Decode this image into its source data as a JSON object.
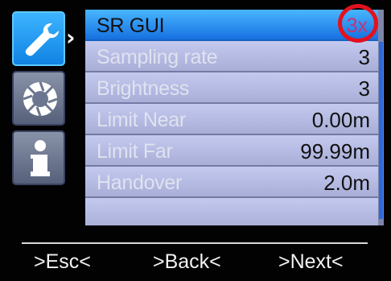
{
  "sidebar": {
    "tabs": [
      {
        "icon": "wrench-icon",
        "selected": true
      },
      {
        "icon": "camera-aperture-icon",
        "selected": false
      },
      {
        "icon": "info-icon",
        "selected": false
      }
    ],
    "indicator": "›"
  },
  "menu": {
    "title": "SR GUI",
    "title_value": "3x",
    "items": [
      {
        "label": "Sampling rate",
        "value": "3"
      },
      {
        "label": "Brightness",
        "value": "3"
      },
      {
        "label": "Limit Near",
        "value": "0.00m"
      },
      {
        "label": "Limit Far",
        "value": "99.99m"
      },
      {
        "label": "Handover",
        "value": "2.0m"
      }
    ]
  },
  "softkeys": {
    "esc": ">Esc<",
    "back": ">Back<",
    "next": ">Next<"
  },
  "colors": {
    "selected_tab": "#2196f3",
    "header_row": "#2b8cf0",
    "menu_row": "#b7bce4",
    "annotation_circle": "#e3111d",
    "header_value": "#c2357a"
  }
}
